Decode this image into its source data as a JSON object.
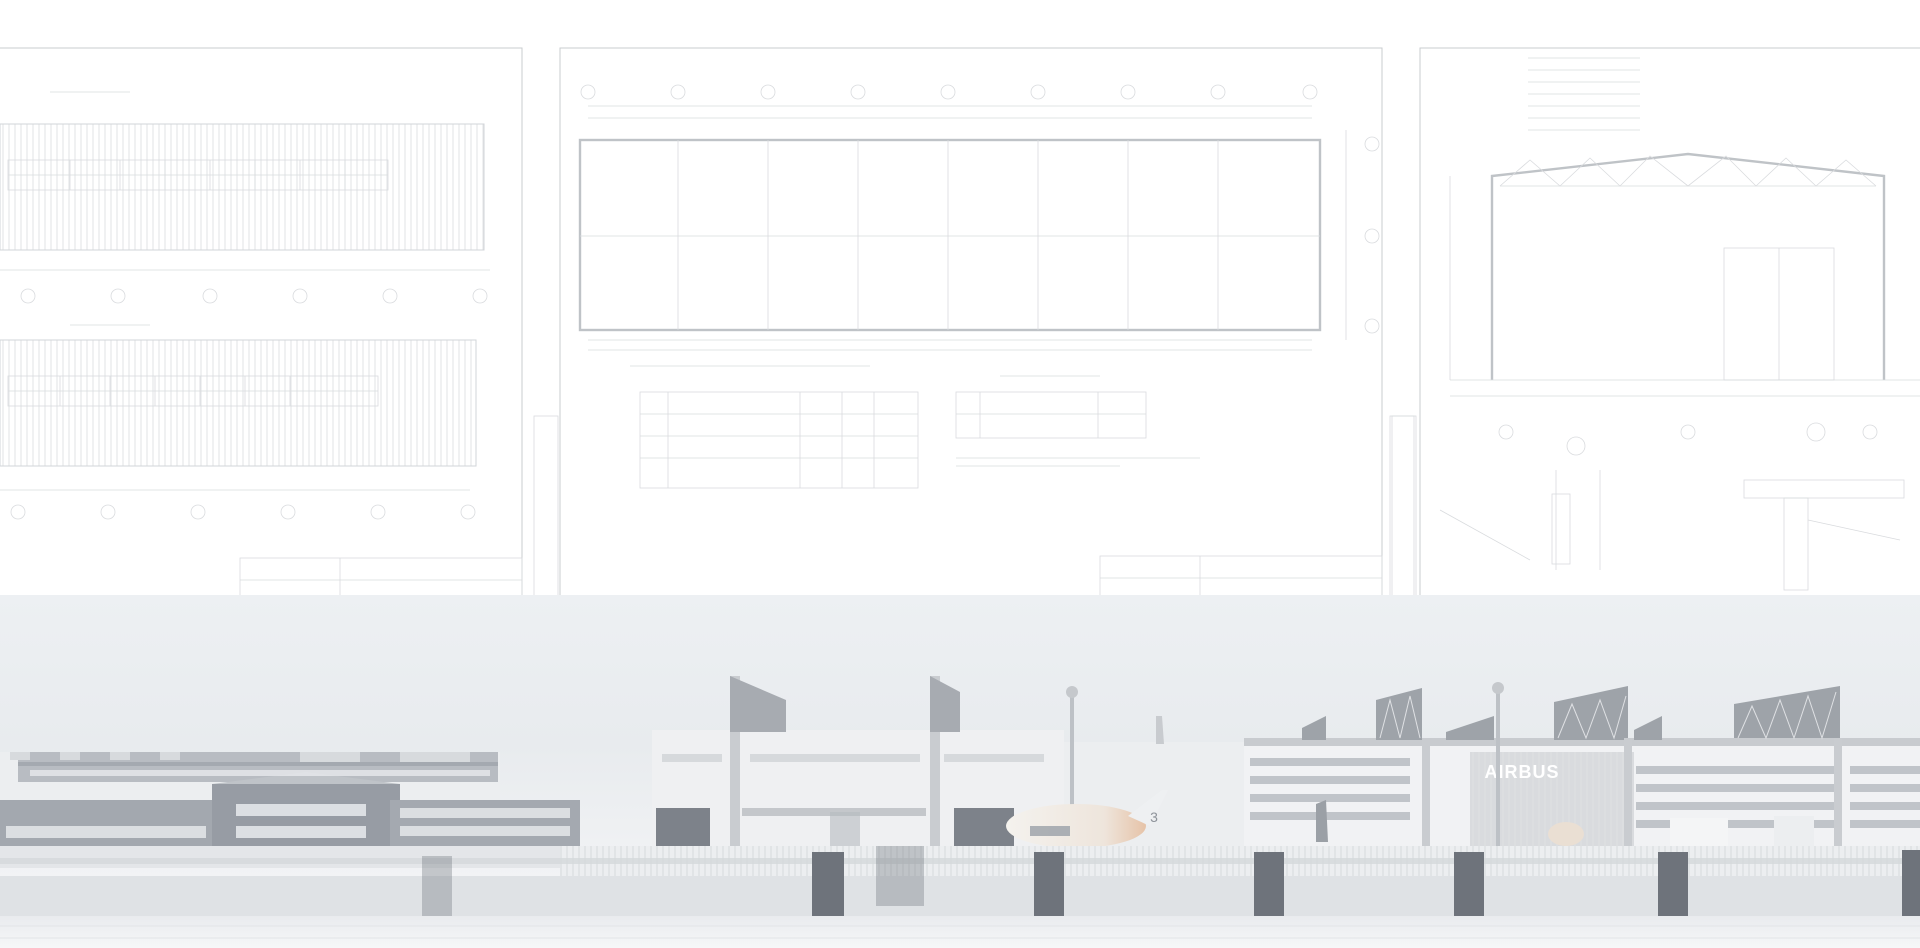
{
  "hero": {
    "logo_text": "AIRBUS",
    "plane_marking": "3",
    "colors": {
      "page_background": "#ffffff",
      "drawing_lines": "#c9cccf",
      "fog_band": "#eef0f3",
      "building_white": "#f2f3f4",
      "brick": "#8b8f96",
      "water": "#f4f5f7"
    }
  }
}
